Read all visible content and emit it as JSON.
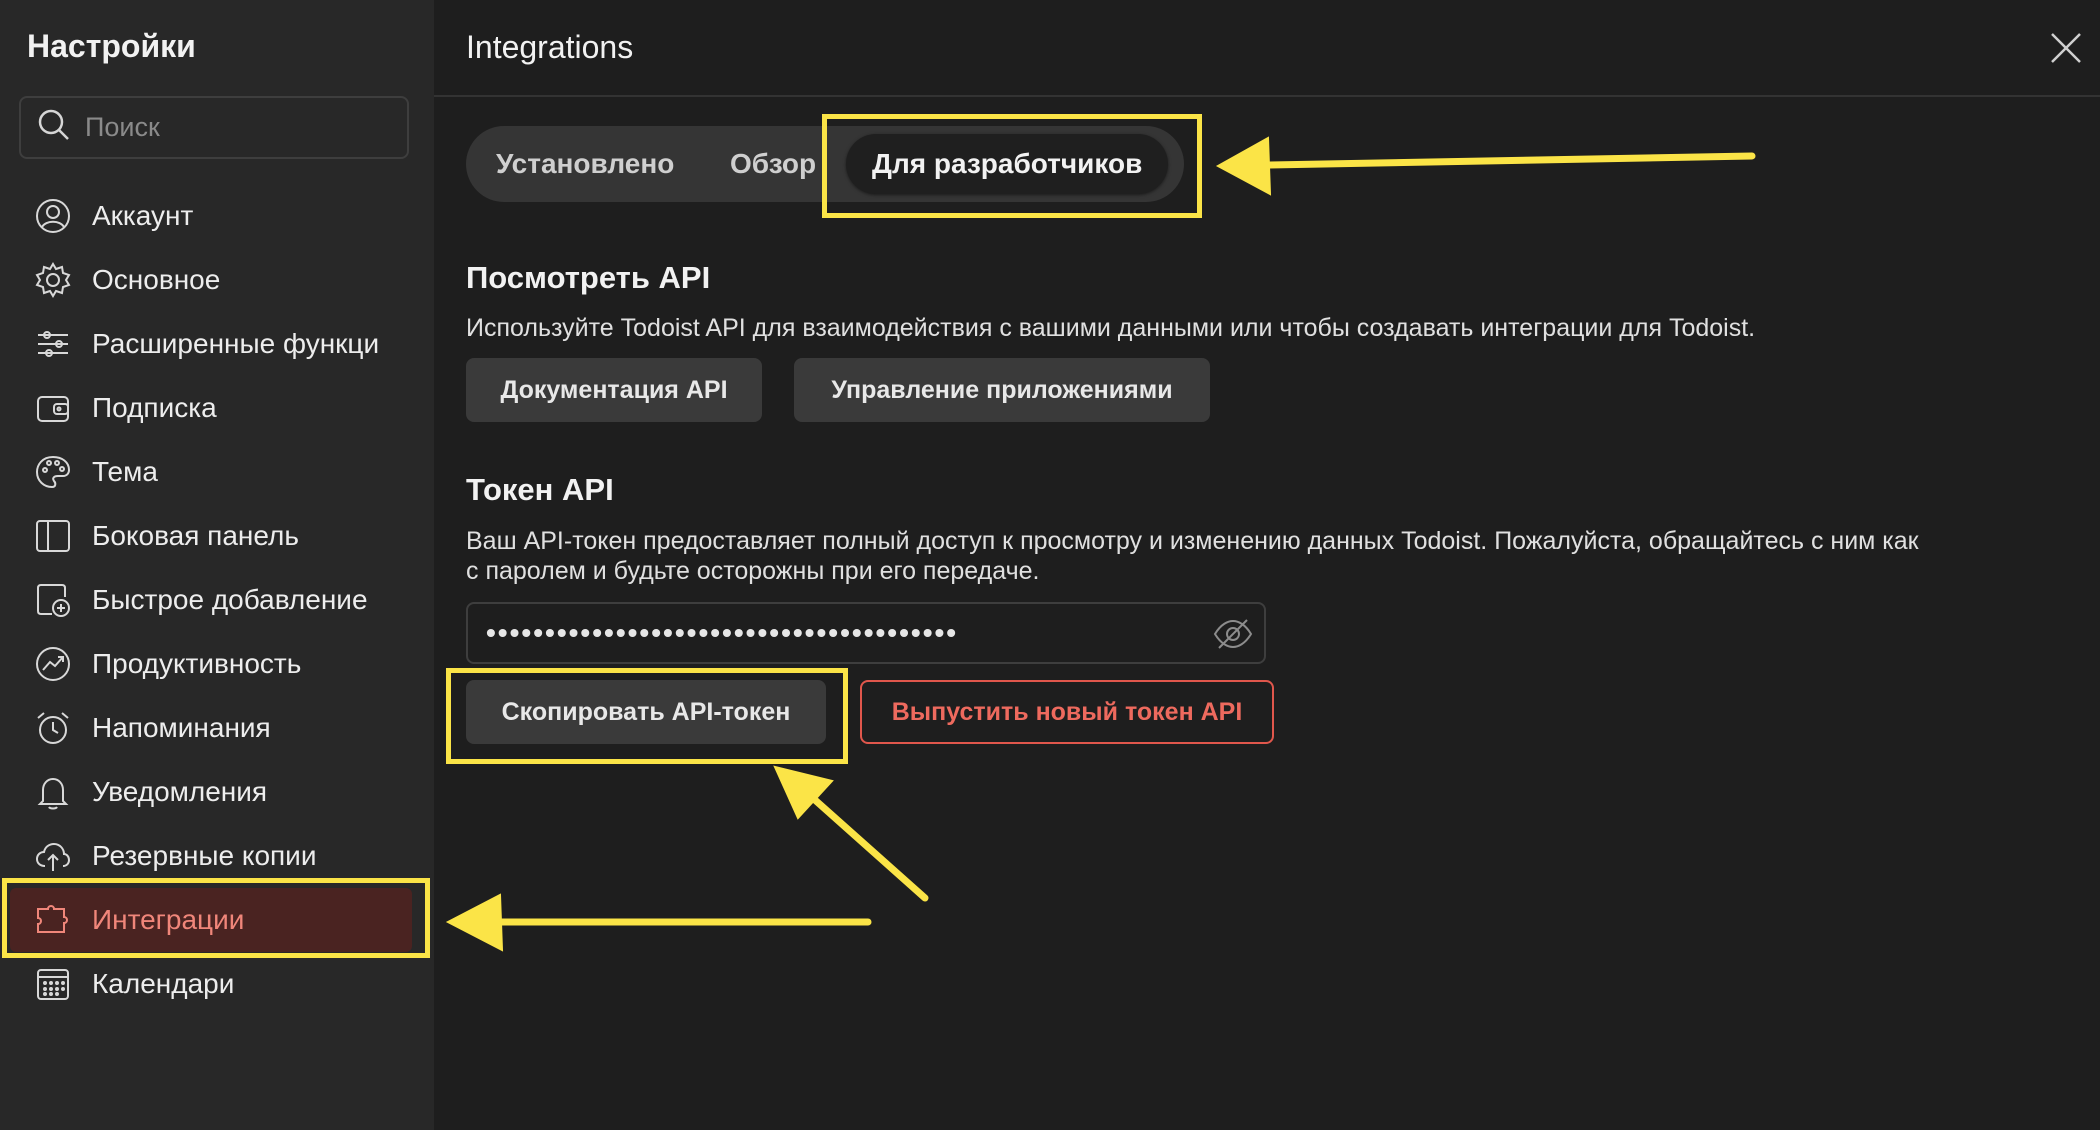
{
  "sidebar": {
    "title": "Настройки",
    "search_placeholder": "Поиск",
    "items": [
      {
        "label": "Аккаунт",
        "icon": "account-icon"
      },
      {
        "label": "Основное",
        "icon": "gear-icon"
      },
      {
        "label": "Расширенные функци",
        "icon": "sliders-icon"
      },
      {
        "label": "Подписка",
        "icon": "wallet-icon"
      },
      {
        "label": "Тема",
        "icon": "palette-icon"
      },
      {
        "label": "Боковая панель",
        "icon": "sidebar-icon"
      },
      {
        "label": "Быстрое добавление",
        "icon": "quick-add-icon"
      },
      {
        "label": "Продуктивность",
        "icon": "productivity-icon"
      },
      {
        "label": "Напоминания",
        "icon": "alarm-icon"
      },
      {
        "label": "Уведомления",
        "icon": "bell-icon"
      },
      {
        "label": "Резервные копии",
        "icon": "cloud-upload-icon"
      },
      {
        "label": "Интеграции",
        "icon": "puzzle-icon",
        "active": true
      },
      {
        "label": "Календари",
        "icon": "calendar-icon"
      }
    ]
  },
  "main": {
    "title": "Integrations",
    "tabs": [
      {
        "label": "Установлено"
      },
      {
        "label": "Обзор"
      },
      {
        "label": "Для разработчиков",
        "active": true
      }
    ],
    "api_section": {
      "heading": "Посмотреть API",
      "description": "Используйте Todoist API для взаимодействия с вашими данными или чтобы создавать интеграции для Todoist.",
      "docs_button": "Документация API",
      "apps_button": "Управление приложениями"
    },
    "token_section": {
      "heading": "Токен API",
      "description_line1": "Ваш API-токен предоставляет полный доступ к просмотру и изменению данных Todoist. Пожалуйста, обращайтесь с ним как",
      "description_line2": "с паролем и будьте осторожны при его передаче.",
      "token_masked": "••••••••••••••••••••••••••••••••••••••••",
      "copy_button": "Скопировать API-токен",
      "reissue_button": "Выпустить новый токен API"
    }
  },
  "colors": {
    "background": "#1e1e1e",
    "sidebar": "#282828",
    "active_item_bg": "#4a2321",
    "accent_red": "#ee6a5e",
    "annotation_yellow": "#fbe447"
  }
}
